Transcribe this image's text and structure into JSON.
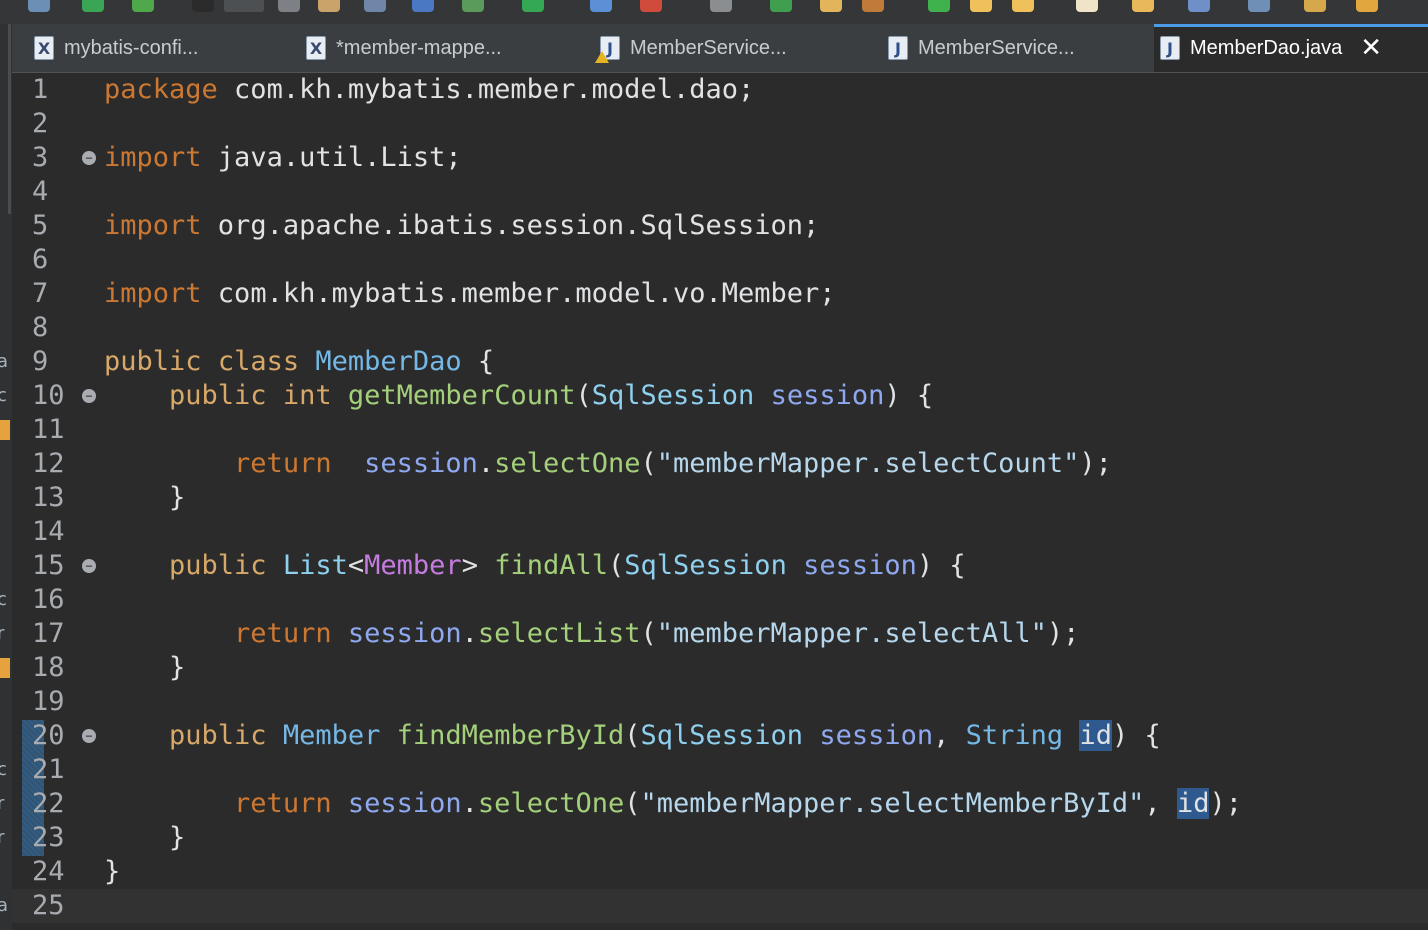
{
  "toolbar": {
    "icons": [
      "search-icon",
      "run-icon",
      "spring-icon",
      "triangle-icon",
      "edit-icon",
      "pin-icon",
      "package-icon",
      "list-icon",
      "bar-icon",
      "arrow-icon",
      "play-icon",
      "external-tools-icon",
      "terminate-icon",
      "stop-icon",
      "debug-icon",
      "open-icon",
      "grid-icon",
      "coverage-icon",
      "folder-icon",
      "folder-open-icon",
      "hand-icon",
      "annotation-icon",
      "settings-icon",
      "layout-icon",
      "back-icon",
      "forward-icon"
    ]
  },
  "left_strip": {
    "letters": [
      {
        "row": 9,
        "text": "a"
      },
      {
        "row": 10,
        "text": "c"
      },
      {
        "row": 16,
        "text": "c"
      },
      {
        "row": 17,
        "text": "r"
      },
      {
        "row": 21,
        "text": "c"
      },
      {
        "row": 22,
        "text": "r"
      },
      {
        "row": 23,
        "text": "r"
      },
      {
        "row": 25,
        "text": "a"
      }
    ]
  },
  "tabs": [
    {
      "label": "mybatis-confi...",
      "icon": "xml-file-icon",
      "icon_text": "X",
      "warning": false,
      "active": false
    },
    {
      "label": "*member-mappe...",
      "icon": "xml-file-icon",
      "icon_text": "X",
      "warning": false,
      "active": false
    },
    {
      "label": "MemberService...",
      "icon": "java-file-icon",
      "icon_text": "J",
      "warning": true,
      "active": false
    },
    {
      "label": "MemberService...",
      "icon": "java-file-icon",
      "icon_text": "J",
      "warning": false,
      "active": false
    },
    {
      "label": "MemberDao.java",
      "icon": "java-file-icon",
      "icon_text": "J",
      "warning": false,
      "active": true,
      "close": "✕"
    }
  ],
  "editor": {
    "current_line": 25,
    "lines": [
      {
        "n": "1",
        "fold": false,
        "tokens": [
          [
            "kw",
            "package"
          ],
          [
            "p",
            " com.kh.mybatis.member.model.dao;"
          ]
        ]
      },
      {
        "n": "2",
        "fold": false,
        "tokens": []
      },
      {
        "n": "3",
        "fold": true,
        "tokens": [
          [
            "kw",
            "import"
          ],
          [
            "p",
            " java.util.List;"
          ]
        ]
      },
      {
        "n": "4",
        "fold": false,
        "tokens": []
      },
      {
        "n": "5",
        "fold": false,
        "tokens": [
          [
            "kw",
            "import"
          ],
          [
            "p",
            " org.apache.ibatis.session.SqlSession;"
          ]
        ]
      },
      {
        "n": "6",
        "fold": false,
        "tokens": []
      },
      {
        "n": "7",
        "fold": false,
        "tokens": [
          [
            "kw",
            "import"
          ],
          [
            "p",
            " com.kh.mybatis.member.model.vo.Member;"
          ]
        ]
      },
      {
        "n": "8",
        "fold": false,
        "tokens": []
      },
      {
        "n": "9",
        "fold": false,
        "tokens": [
          [
            "kw2",
            "public"
          ],
          [
            "p",
            " "
          ],
          [
            "kw2",
            "class"
          ],
          [
            "p",
            " "
          ],
          [
            "cls",
            "MemberDao"
          ],
          [
            "p",
            " {"
          ]
        ]
      },
      {
        "n": "10",
        "fold": true,
        "tokens": [
          [
            "p",
            "    "
          ],
          [
            "kw2",
            "public"
          ],
          [
            "p",
            " "
          ],
          [
            "kw2",
            "int"
          ],
          [
            "p",
            " "
          ],
          [
            "meth",
            "getMemberCount"
          ],
          [
            "p",
            "("
          ],
          [
            "type",
            "SqlSession"
          ],
          [
            "p",
            " "
          ],
          [
            "var",
            "session"
          ],
          [
            "p",
            ") {"
          ]
        ]
      },
      {
        "n": "11",
        "fold": false,
        "tokens": []
      },
      {
        "n": "12",
        "fold": false,
        "tokens": [
          [
            "p",
            "        "
          ],
          [
            "kw",
            "return"
          ],
          [
            "p",
            "  "
          ],
          [
            "var",
            "session"
          ],
          [
            "p",
            "."
          ],
          [
            "meth",
            "selectOne"
          ],
          [
            "p",
            "("
          ],
          [
            "str",
            "\"memberMapper.selectCount\""
          ],
          [
            "p",
            ");"
          ]
        ]
      },
      {
        "n": "13",
        "fold": false,
        "tokens": [
          [
            "p",
            "    }"
          ]
        ]
      },
      {
        "n": "14",
        "fold": false,
        "tokens": []
      },
      {
        "n": "15",
        "fold": true,
        "tokens": [
          [
            "p",
            "    "
          ],
          [
            "kw2",
            "public"
          ],
          [
            "p",
            " "
          ],
          [
            "type",
            "List"
          ],
          [
            "p",
            "<"
          ],
          [
            "gen",
            "Member"
          ],
          [
            "p",
            "> "
          ],
          [
            "meth",
            "findAll"
          ],
          [
            "p",
            "("
          ],
          [
            "type",
            "SqlSession"
          ],
          [
            "p",
            " "
          ],
          [
            "var",
            "session"
          ],
          [
            "p",
            ") {"
          ]
        ]
      },
      {
        "n": "16",
        "fold": false,
        "tokens": []
      },
      {
        "n": "17",
        "fold": false,
        "tokens": [
          [
            "p",
            "        "
          ],
          [
            "kw",
            "return"
          ],
          [
            "p",
            " "
          ],
          [
            "var",
            "session"
          ],
          [
            "p",
            "."
          ],
          [
            "meth",
            "selectList"
          ],
          [
            "p",
            "("
          ],
          [
            "str",
            "\"memberMapper.selectAll\""
          ],
          [
            "p",
            ");"
          ]
        ]
      },
      {
        "n": "18",
        "fold": false,
        "tokens": [
          [
            "p",
            "    }"
          ]
        ]
      },
      {
        "n": "19",
        "fold": false,
        "tokens": []
      },
      {
        "n": "20",
        "fold": true,
        "tokens": [
          [
            "p",
            "    "
          ],
          [
            "kw2",
            "public"
          ],
          [
            "p",
            " "
          ],
          [
            "cls",
            "Member"
          ],
          [
            "p",
            " "
          ],
          [
            "meth",
            "findMemberById"
          ],
          [
            "p",
            "("
          ],
          [
            "type",
            "SqlSession"
          ],
          [
            "p",
            " "
          ],
          [
            "var",
            "session"
          ],
          [
            "p",
            ", "
          ],
          [
            "cls",
            "String"
          ],
          [
            "p",
            " "
          ],
          [
            "hl",
            "id"
          ],
          [
            "p",
            ") {"
          ]
        ]
      },
      {
        "n": "21",
        "fold": false,
        "tokens": []
      },
      {
        "n": "22",
        "fold": false,
        "tokens": [
          [
            "p",
            "        "
          ],
          [
            "kw",
            "return"
          ],
          [
            "p",
            " "
          ],
          [
            "var",
            "session"
          ],
          [
            "p",
            "."
          ],
          [
            "meth",
            "selectOne"
          ],
          [
            "p",
            "("
          ],
          [
            "str",
            "\"memberMapper.selectMemberById\""
          ],
          [
            "p",
            ", "
          ],
          [
            "hl",
            "id"
          ],
          [
            "p",
            ");"
          ]
        ]
      },
      {
        "n": "23",
        "fold": false,
        "tokens": [
          [
            "p",
            "    }"
          ]
        ]
      },
      {
        "n": "24",
        "fold": false,
        "tokens": [
          [
            "p",
            "}"
          ]
        ]
      },
      {
        "n": "25",
        "fold": false,
        "tokens": []
      }
    ]
  },
  "colors": {
    "background": "#2b2b2b",
    "keyword": "#cc7832",
    "class": "#75b8e6",
    "method": "#a4d07b",
    "variable": "#8fa9f0",
    "string": "#b6d7ec",
    "generic": "#c67be0",
    "active_tab_indicator": "#4b9ce6"
  }
}
